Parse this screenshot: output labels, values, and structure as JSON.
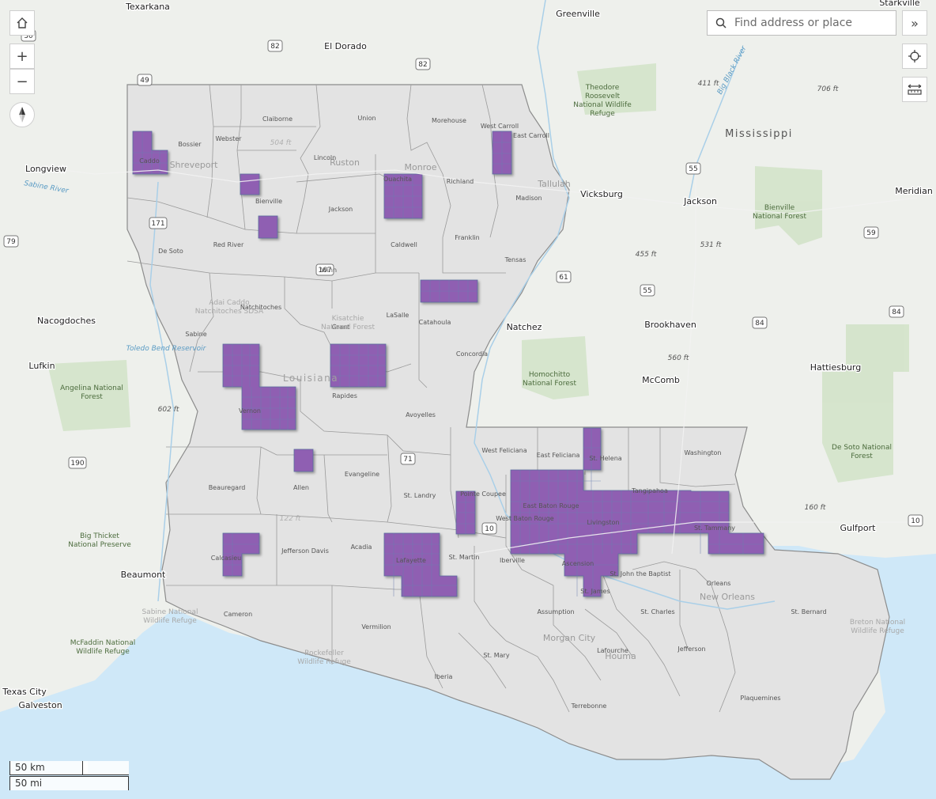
{
  "controls": {
    "home_icon": "home-icon",
    "zoom_in_label": "+",
    "zoom_out_label": "−",
    "compass_icon": "compass-icon",
    "expand_label": "»",
    "locate_icon": "locate-icon",
    "measure_icon": "measure-icon"
  },
  "search": {
    "placeholder": "Find address or place"
  },
  "scalebar": {
    "metric": "50 km",
    "imperial": "50 mi"
  },
  "colors": {
    "highlight": "#8f5fb2",
    "highlight_stroke": "#5a6f9e",
    "state": "#e2e2e2",
    "water": "#cfe8f8"
  },
  "map_labels": {
    "cities": [
      "Texarkana",
      "El Dorado",
      "Greenville",
      "Starkville",
      "Longview",
      "Shreveport",
      "Monroe",
      "Ruston",
      "Tallulah",
      "Vicksburg",
      "Jackson",
      "Meridian",
      "Nacogdoches",
      "Lufkin",
      "Natchez",
      "Brookhaven",
      "McComb",
      "Hattiesburg",
      "Beaumont",
      "Gulfport",
      "Texas City",
      "Galveston",
      "New Orleans",
      "Houma",
      "Morgan City"
    ],
    "states": [
      "Mississippi",
      "Louisiana"
    ],
    "parishes": [
      "Caddo",
      "Bossier",
      "Webster",
      "Claiborne",
      "Union",
      "Morehouse",
      "West Carroll",
      "East Carroll",
      "Lincoln",
      "Ouachita",
      "Richland",
      "Madison",
      "Bienville",
      "Jackson",
      "Red River",
      "De Soto",
      "Caldwell",
      "Franklin",
      "Tensas",
      "Winn",
      "Natchitoches",
      "Grant",
      "LaSalle",
      "Catahoula",
      "Concordia",
      "Sabine",
      "Rapides",
      "Vernon",
      "Avoyelles",
      "West Feliciana",
      "East Feliciana",
      "St. Helena",
      "Washington",
      "Beauregard",
      "Allen",
      "Evangeline",
      "St. Landry",
      "Pointe Coupee",
      "East Baton Rouge",
      "West Baton Rouge",
      "Livingston",
      "Tangipahoa",
      "St. Tammany",
      "Calcasieu",
      "Jefferson Davis",
      "Acadia",
      "Lafayette",
      "St. Martin",
      "Iberville",
      "Ascension",
      "St. John the Baptist",
      "Orleans",
      "St. James",
      "Cameron",
      "Vermilion",
      "Assumption",
      "St. Charles",
      "St. Bernard",
      "Lafourche",
      "Jefferson",
      "St. Mary",
      "Iberia",
      "Terrebonne",
      "Plaquemines"
    ],
    "parks": [
      "Theodore Roosevelt National Wildlife Refuge",
      "Bienville National Forest",
      "Homochitto National Forest",
      "De Soto National Forest",
      "Angelina National Forest",
      "Big Thicket National Preserve",
      "McFaddin National Wildlife Refuge",
      "Sabine National Wildlife Refuge",
      "Rockefeller Wildlife Refuge",
      "Breton National Wildlife Refuge",
      "Kisatchie National Forest",
      "Adai Caddo Natchitoches SDSA"
    ],
    "water": [
      "Sabine River",
      "Big Black River",
      "Toledo Bend Reservoir"
    ],
    "elevations": [
      "411 ft",
      "706 ft",
      "504 ft",
      "455 ft",
      "531 ft",
      "560 ft",
      "602 ft",
      "160 ft",
      "122 ft"
    ],
    "highways": [
      "82",
      "82",
      "30",
      "59",
      "55",
      "61",
      "55",
      "84",
      "84",
      "79",
      "190",
      "10",
      "10",
      "167",
      "171",
      "71",
      "49"
    ]
  }
}
